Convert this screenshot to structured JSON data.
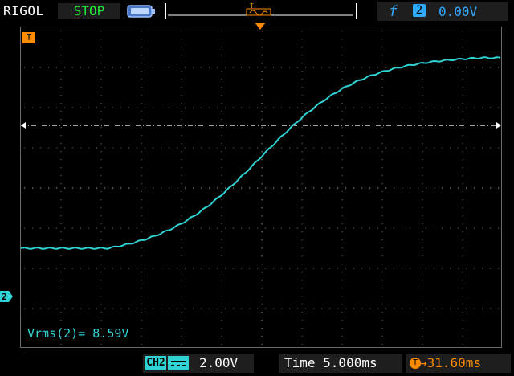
{
  "header": {
    "brand": "RIGOL",
    "run_state": "STOP",
    "trigger": {
      "slope_symbol": "f",
      "source": "2",
      "level": "0.00V"
    }
  },
  "markers": {
    "trigger_time_label": "T",
    "trigger_level_label": "T",
    "channel_ground_label": "2"
  },
  "measurement": "Vrms(2)= 8.59V",
  "footer": {
    "channel_tag": "CH2",
    "channel_scale": "2.00V",
    "timebase": "Time 5.000ms",
    "trigger_offset": "31.60ms"
  },
  "colors": {
    "trace": "#2fd3d3",
    "trigger": "#ff8c00",
    "run_state": "#22e83c",
    "trigger_info": "#2fa8ff"
  }
}
